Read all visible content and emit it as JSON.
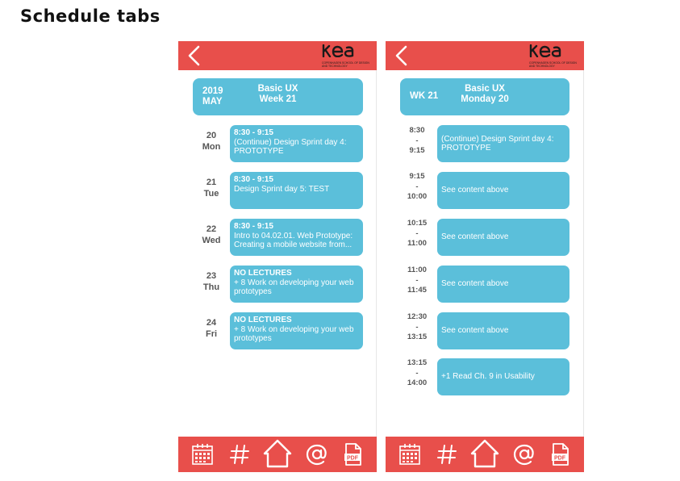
{
  "page_title": "Schedule tabs",
  "colors": {
    "brand_red": "#e84f4b",
    "card_blue": "#5bbfda",
    "text_gray": "#555555",
    "white": "#ffffff"
  },
  "logo": {
    "word": "KEA",
    "subtitle": "Copenhagen School of Design and Technology"
  },
  "icons": [
    "back-arrow-icon",
    "calendar-icon",
    "hashtag-icon",
    "home-icon",
    "at-icon",
    "pdf-icon"
  ],
  "week_view": {
    "header": {
      "year": "2019",
      "month": "MAY",
      "course": "Basic UX",
      "week": "Week 21"
    },
    "days": [
      {
        "day": "20",
        "weekday": "Mon",
        "time": "8:30 - 9:15",
        "text": "(Continue) Design Sprint day 4: PROTOTYPE"
      },
      {
        "day": "21",
        "weekday": "Tue",
        "time": "8:30 - 9:15",
        "text": "Design Sprint day 5: TEST"
      },
      {
        "day": "22",
        "weekday": "Wed",
        "time": "8:30 - 9:15",
        "text": "Intro to 04.02.01. Web Prototype: Creating a mobile website from..."
      },
      {
        "day": "23",
        "weekday": "Thu",
        "time": "NO LECTURES",
        "text": "+ 8 Work on developing your web prototypes"
      },
      {
        "day": "24",
        "weekday": "Fri",
        "time": "NO LECTURES",
        "text": "+ 8 Work on developing your web prototypes"
      }
    ]
  },
  "day_view": {
    "header": {
      "week": "WK 21",
      "course": "Basic UX",
      "day": "Monday 20"
    },
    "slots": [
      {
        "start": "8:30",
        "sep": "-",
        "end": "9:15",
        "text": "(Continue) Design Sprint day 4: PROTOTYPE"
      },
      {
        "start": "9:15",
        "sep": "-",
        "end": "10:00",
        "text": "See content above"
      },
      {
        "start": "10:15",
        "sep": "-",
        "end": "11:00",
        "text": "See content above"
      },
      {
        "start": "11:00",
        "sep": "-",
        "end": "11:45",
        "text": "See content above"
      },
      {
        "start": "12:30",
        "sep": "-",
        "end": "13:15",
        "text": "See content above"
      },
      {
        "start": "13:15",
        "sep": "-",
        "end": "14:00",
        "text": "+1 Read Ch. 9 in Usability"
      }
    ]
  },
  "pdf_icon_label": "PDF"
}
